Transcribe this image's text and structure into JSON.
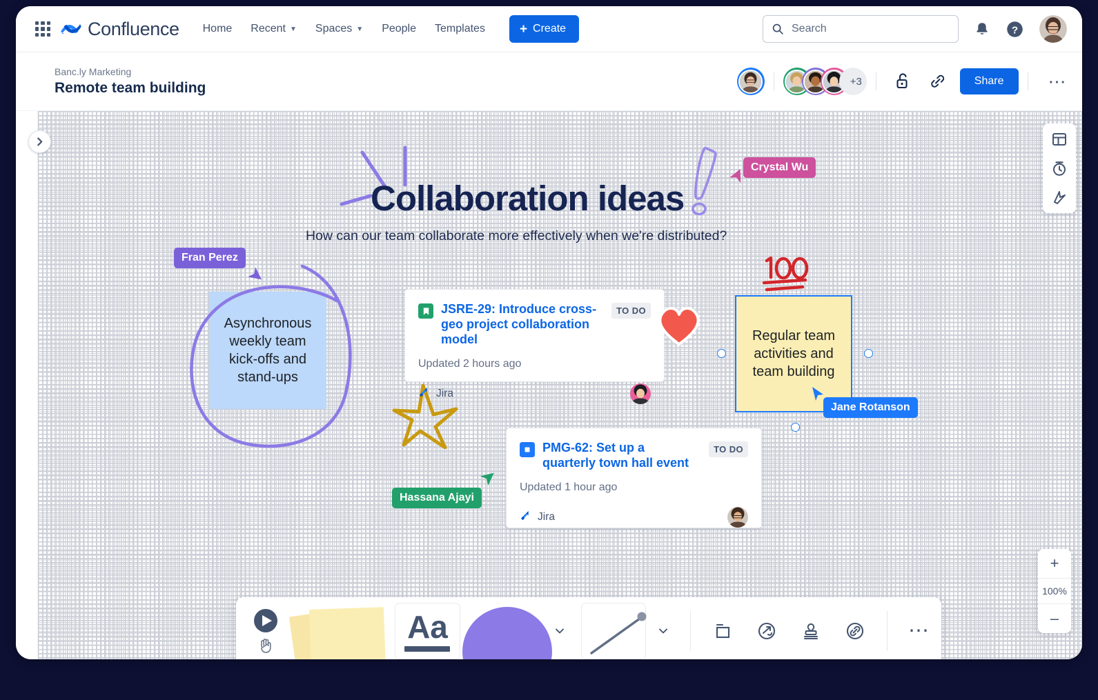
{
  "app": {
    "product_name": "Confluence",
    "accent_blue": "#0c66e4",
    "nav_items": [
      {
        "label": "Home",
        "caret": false
      },
      {
        "label": "Recent",
        "caret": true
      },
      {
        "label": "Spaces",
        "caret": true
      },
      {
        "label": "People",
        "caret": false
      },
      {
        "label": "Templates",
        "caret": false
      }
    ],
    "create_label": "Create",
    "search_placeholder": "Search"
  },
  "page_header": {
    "breadcrumb_space": "Banc.ly Marketing",
    "title": "Remote team building",
    "extra_collaborators": "+3",
    "share_label": "Share"
  },
  "board": {
    "title": "Collaboration ideas",
    "subtitle": "How can our team collaborate more effectively when we're distributed?",
    "sticky_notes": [
      {
        "id": "note-async",
        "text": "Asynchronous weekly team kick-offs and stand-ups",
        "color": "#bcd8fa",
        "selected": false
      },
      {
        "id": "note-team-activities",
        "text": "Regular team activities and team building",
        "color": "#fbeeb4",
        "selected": true
      }
    ],
    "cursors": [
      {
        "name": "Crystal Wu",
        "color": "#cd519d"
      },
      {
        "name": "Fran Perez",
        "color": "#7b61d9"
      },
      {
        "name": "Hassana Ajayi",
        "color": "#22a06b"
      },
      {
        "name": "Jane Rotanson",
        "color": "#1d7afc"
      }
    ],
    "reactions": [
      {
        "name": "hundred-points-emoji",
        "color": "#d1262b"
      },
      {
        "name": "red-heart-emoji",
        "color": "#f2594c"
      }
    ],
    "jira_cards": [
      {
        "key_and_summary": "JSRE-29: Introduce cross-geo project collaboration model",
        "status": "TO DO",
        "updated": "Updated 2 hours ago",
        "source": "Jira",
        "issue_type_color": "#22a06b",
        "issue_type": "story"
      },
      {
        "key_and_summary": "PMG-62: Set up a quarterly town hall event",
        "status": "TO DO",
        "updated": "Updated 1 hour ago",
        "source": "Jira",
        "issue_type_color": "#1d7afc",
        "issue_type": "task"
      }
    ]
  },
  "toolbar": {
    "tools": [
      {
        "name": "select-tool",
        "label": "Select"
      },
      {
        "name": "hand-tool",
        "label": "Pan"
      },
      {
        "name": "sticky-note-tool",
        "label": "Sticky note"
      },
      {
        "name": "text-tool",
        "label": "Aa"
      },
      {
        "name": "shape-tool",
        "label": "Shape"
      },
      {
        "name": "shape-more",
        "label": "Shape options"
      },
      {
        "name": "line-tool",
        "label": "Line"
      },
      {
        "name": "line-more",
        "label": "Line options"
      },
      {
        "name": "frame-tool",
        "label": "Frame"
      },
      {
        "name": "timer-tool",
        "label": "Timer"
      },
      {
        "name": "stamp-tool",
        "label": "Stamp"
      },
      {
        "name": "link-tool",
        "label": "Link"
      },
      {
        "name": "more-tools",
        "label": "More"
      }
    ],
    "text_tool_label": "Aa"
  },
  "right_tools": [
    {
      "name": "templates-panel-icon",
      "label": "Templates"
    },
    {
      "name": "timer-icon",
      "label": "Timer"
    },
    {
      "name": "smart-links-icon",
      "label": "Smart sections"
    }
  ],
  "zoom_control": {
    "zoom_in": "+",
    "level": "100%",
    "zoom_out": "–"
  }
}
